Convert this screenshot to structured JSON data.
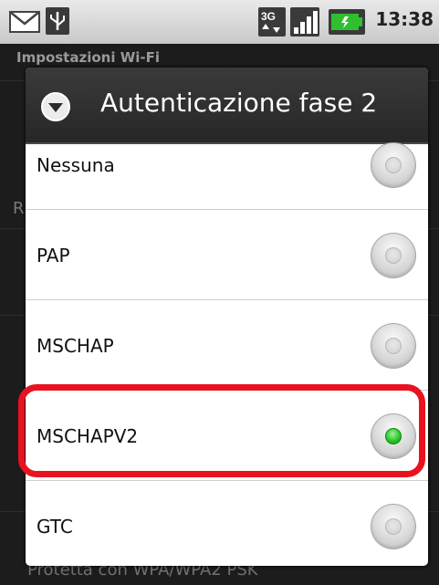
{
  "status_bar": {
    "time": "13:38",
    "icons": [
      "gmail-icon",
      "usb-icon",
      "3g-data-icon",
      "signal-icon",
      "battery-icon"
    ]
  },
  "background": {
    "screen_title": "Impostazioni Wi-Fi",
    "partial_letter": "R",
    "footer_text": "Protetta con WPA/WPA2 PSK"
  },
  "dialog": {
    "title": "Autenticazione fase 2",
    "options": [
      {
        "label": "Nessuna",
        "selected": false
      },
      {
        "label": "PAP",
        "selected": false
      },
      {
        "label": "MSCHAP",
        "selected": false
      },
      {
        "label": "MSCHAPV2",
        "selected": true
      },
      {
        "label": "GTC",
        "selected": false
      }
    ]
  },
  "colors": {
    "highlight": "#e8131f",
    "radio_selected": "#22c322"
  }
}
